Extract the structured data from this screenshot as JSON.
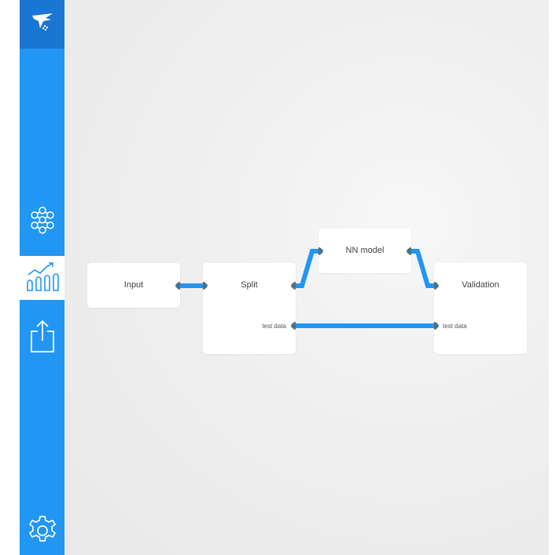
{
  "sidebar": {
    "logo_icon": "bird-logo-icon",
    "items": [
      {
        "icon": "network-graph-icon",
        "active": false
      },
      {
        "icon": "bar-chart-trend-icon",
        "active": true
      },
      {
        "icon": "export-share-icon",
        "active": false
      },
      {
        "icon": "gear-icon",
        "active": false
      }
    ]
  },
  "canvas": {
    "nodes": [
      {
        "id": "input",
        "title": "Input"
      },
      {
        "id": "split",
        "title": "Split",
        "output_label": "test data"
      },
      {
        "id": "nn_model",
        "title": "NN model"
      },
      {
        "id": "validation",
        "title": "Validation",
        "input_label": "test data"
      }
    ]
  },
  "colors": {
    "sidebar": "#2196f3",
    "logo_tile": "#1976d2",
    "wire": "#2196f3",
    "port": "#546e7a",
    "canvas": "#efefef"
  }
}
